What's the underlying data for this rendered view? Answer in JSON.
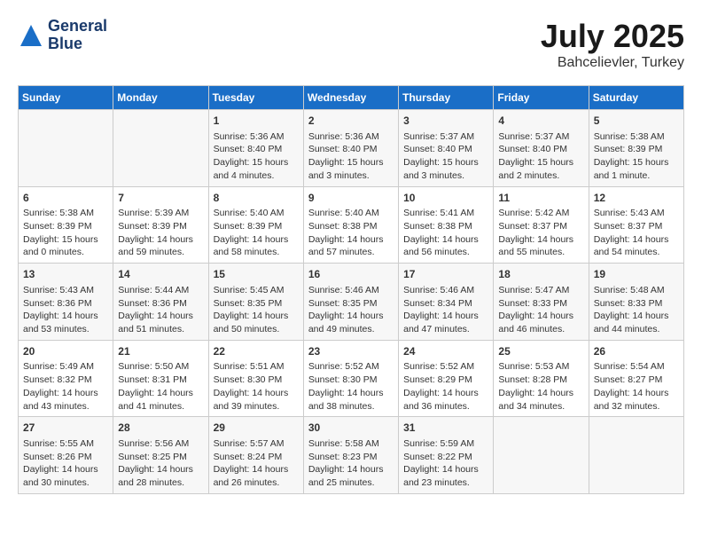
{
  "header": {
    "logo_line1": "General",
    "logo_line2": "Blue",
    "title": "July 2025",
    "subtitle": "Bahcelievler, Turkey"
  },
  "days_of_week": [
    "Sunday",
    "Monday",
    "Tuesday",
    "Wednesday",
    "Thursday",
    "Friday",
    "Saturday"
  ],
  "weeks": [
    [
      {
        "day": "",
        "info": ""
      },
      {
        "day": "",
        "info": ""
      },
      {
        "day": "1",
        "info": "Sunrise: 5:36 AM\nSunset: 8:40 PM\nDaylight: 15 hours and 4 minutes."
      },
      {
        "day": "2",
        "info": "Sunrise: 5:36 AM\nSunset: 8:40 PM\nDaylight: 15 hours and 3 minutes."
      },
      {
        "day": "3",
        "info": "Sunrise: 5:37 AM\nSunset: 8:40 PM\nDaylight: 15 hours and 3 minutes."
      },
      {
        "day": "4",
        "info": "Sunrise: 5:37 AM\nSunset: 8:40 PM\nDaylight: 15 hours and 2 minutes."
      },
      {
        "day": "5",
        "info": "Sunrise: 5:38 AM\nSunset: 8:39 PM\nDaylight: 15 hours and 1 minute."
      }
    ],
    [
      {
        "day": "6",
        "info": "Sunrise: 5:38 AM\nSunset: 8:39 PM\nDaylight: 15 hours and 0 minutes."
      },
      {
        "day": "7",
        "info": "Sunrise: 5:39 AM\nSunset: 8:39 PM\nDaylight: 14 hours and 59 minutes."
      },
      {
        "day": "8",
        "info": "Sunrise: 5:40 AM\nSunset: 8:39 PM\nDaylight: 14 hours and 58 minutes."
      },
      {
        "day": "9",
        "info": "Sunrise: 5:40 AM\nSunset: 8:38 PM\nDaylight: 14 hours and 57 minutes."
      },
      {
        "day": "10",
        "info": "Sunrise: 5:41 AM\nSunset: 8:38 PM\nDaylight: 14 hours and 56 minutes."
      },
      {
        "day": "11",
        "info": "Sunrise: 5:42 AM\nSunset: 8:37 PM\nDaylight: 14 hours and 55 minutes."
      },
      {
        "day": "12",
        "info": "Sunrise: 5:43 AM\nSunset: 8:37 PM\nDaylight: 14 hours and 54 minutes."
      }
    ],
    [
      {
        "day": "13",
        "info": "Sunrise: 5:43 AM\nSunset: 8:36 PM\nDaylight: 14 hours and 53 minutes."
      },
      {
        "day": "14",
        "info": "Sunrise: 5:44 AM\nSunset: 8:36 PM\nDaylight: 14 hours and 51 minutes."
      },
      {
        "day": "15",
        "info": "Sunrise: 5:45 AM\nSunset: 8:35 PM\nDaylight: 14 hours and 50 minutes."
      },
      {
        "day": "16",
        "info": "Sunrise: 5:46 AM\nSunset: 8:35 PM\nDaylight: 14 hours and 49 minutes."
      },
      {
        "day": "17",
        "info": "Sunrise: 5:46 AM\nSunset: 8:34 PM\nDaylight: 14 hours and 47 minutes."
      },
      {
        "day": "18",
        "info": "Sunrise: 5:47 AM\nSunset: 8:33 PM\nDaylight: 14 hours and 46 minutes."
      },
      {
        "day": "19",
        "info": "Sunrise: 5:48 AM\nSunset: 8:33 PM\nDaylight: 14 hours and 44 minutes."
      }
    ],
    [
      {
        "day": "20",
        "info": "Sunrise: 5:49 AM\nSunset: 8:32 PM\nDaylight: 14 hours and 43 minutes."
      },
      {
        "day": "21",
        "info": "Sunrise: 5:50 AM\nSunset: 8:31 PM\nDaylight: 14 hours and 41 minutes."
      },
      {
        "day": "22",
        "info": "Sunrise: 5:51 AM\nSunset: 8:30 PM\nDaylight: 14 hours and 39 minutes."
      },
      {
        "day": "23",
        "info": "Sunrise: 5:52 AM\nSunset: 8:30 PM\nDaylight: 14 hours and 38 minutes."
      },
      {
        "day": "24",
        "info": "Sunrise: 5:52 AM\nSunset: 8:29 PM\nDaylight: 14 hours and 36 minutes."
      },
      {
        "day": "25",
        "info": "Sunrise: 5:53 AM\nSunset: 8:28 PM\nDaylight: 14 hours and 34 minutes."
      },
      {
        "day": "26",
        "info": "Sunrise: 5:54 AM\nSunset: 8:27 PM\nDaylight: 14 hours and 32 minutes."
      }
    ],
    [
      {
        "day": "27",
        "info": "Sunrise: 5:55 AM\nSunset: 8:26 PM\nDaylight: 14 hours and 30 minutes."
      },
      {
        "day": "28",
        "info": "Sunrise: 5:56 AM\nSunset: 8:25 PM\nDaylight: 14 hours and 28 minutes."
      },
      {
        "day": "29",
        "info": "Sunrise: 5:57 AM\nSunset: 8:24 PM\nDaylight: 14 hours and 26 minutes."
      },
      {
        "day": "30",
        "info": "Sunrise: 5:58 AM\nSunset: 8:23 PM\nDaylight: 14 hours and 25 minutes."
      },
      {
        "day": "31",
        "info": "Sunrise: 5:59 AM\nSunset: 8:22 PM\nDaylight: 14 hours and 23 minutes."
      },
      {
        "day": "",
        "info": ""
      },
      {
        "day": "",
        "info": ""
      }
    ]
  ]
}
